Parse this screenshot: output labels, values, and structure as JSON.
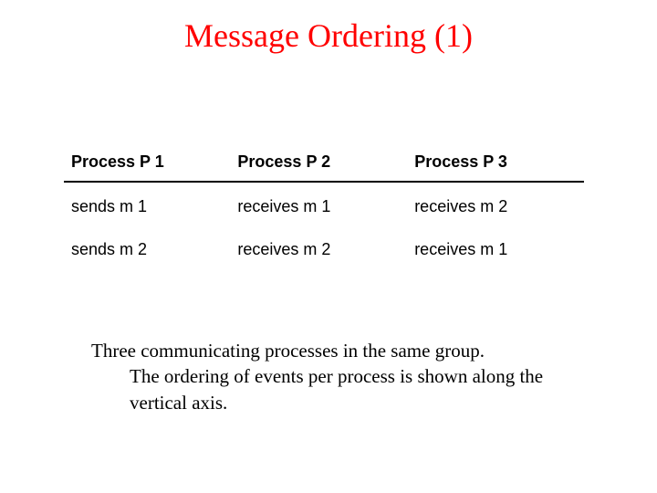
{
  "title": "Message Ordering (1)",
  "table": {
    "headers": [
      "Process P 1",
      "Process P 2",
      "Process P 3"
    ],
    "rows": [
      [
        "sends m 1",
        "receives m 1",
        "receives m 2"
      ],
      [
        "sends m 2",
        "receives m 2",
        "receives m 1"
      ]
    ]
  },
  "caption": {
    "line1": "Three communicating processes in the same group.",
    "line2": "The ordering of events per process is shown along the vertical axis."
  }
}
